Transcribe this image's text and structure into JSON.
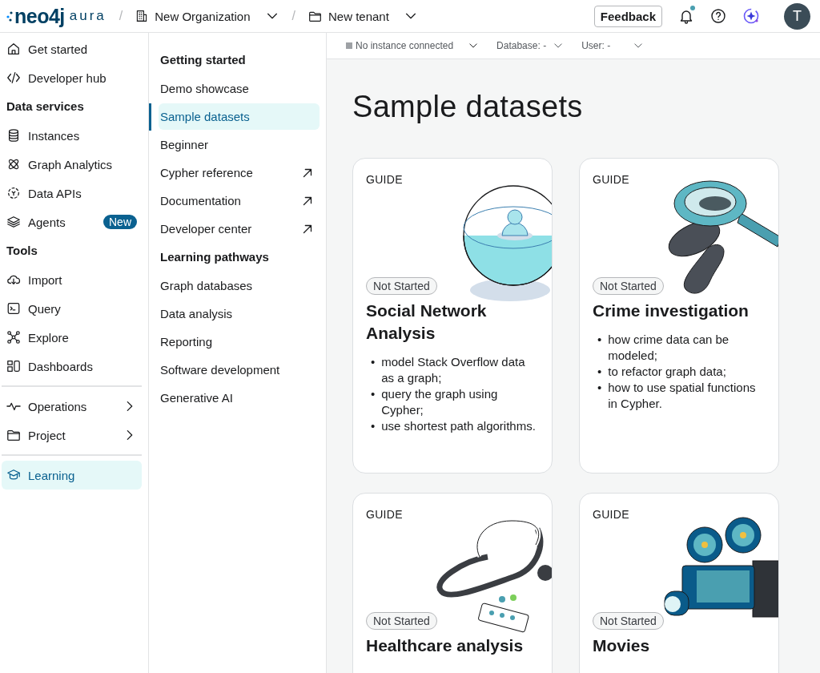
{
  "header": {
    "logo": {
      "brand": "neo4j",
      "product": "aura"
    },
    "separator": "/",
    "breadcrumbs": [
      {
        "label": "New Organization",
        "kind": "organization"
      },
      {
        "label": "New tenant",
        "kind": "folder"
      }
    ],
    "feedback": "Feedback",
    "notifications_unread": true,
    "avatar": "T"
  },
  "sidebar": {
    "sections": [
      {
        "items": [
          {
            "label": "Get started",
            "selected": false
          },
          {
            "label": "Developer hub",
            "selected": false
          }
        ]
      },
      {
        "heading": "Data services",
        "items": [
          {
            "label": "Instances",
            "selected": false
          },
          {
            "label": "Graph Analytics",
            "selected": false
          },
          {
            "label": "Data APIs",
            "selected": false
          },
          {
            "label": "Agents",
            "selected": false,
            "badge": "New"
          }
        ]
      },
      {
        "heading": "Tools",
        "items": [
          {
            "label": "Import",
            "selected": false
          },
          {
            "label": "Query",
            "selected": false
          },
          {
            "label": "Explore",
            "selected": false
          },
          {
            "label": "Dashboards",
            "selected": false
          }
        ]
      },
      {
        "divider": true,
        "items": [
          {
            "label": "Operations",
            "selected": false,
            "submenu": true
          },
          {
            "label": "Project",
            "selected": false,
            "submenu": true
          }
        ]
      },
      {
        "divider": true,
        "items": [
          {
            "label": "Learning",
            "selected": true
          }
        ]
      }
    ]
  },
  "learning_nav": {
    "groups": [
      {
        "heading": "Getting started",
        "items": [
          {
            "label": "Demo showcase",
            "selected": false,
            "external": false
          },
          {
            "label": "Sample datasets",
            "selected": true,
            "external": false
          },
          {
            "label": "Beginner",
            "selected": false,
            "external": false
          },
          {
            "label": "Cypher reference",
            "selected": false,
            "external": true
          },
          {
            "label": "Documentation",
            "selected": false,
            "external": true
          },
          {
            "label": "Developer center",
            "selected": false,
            "external": true
          }
        ]
      },
      {
        "heading": "Learning pathways",
        "items": [
          {
            "label": "Graph databases",
            "selected": false,
            "external": false
          },
          {
            "label": "Data analysis",
            "selected": false,
            "external": false
          },
          {
            "label": "Reporting",
            "selected": false,
            "external": false
          },
          {
            "label": "Software development",
            "selected": false,
            "external": false
          },
          {
            "label": "Generative AI",
            "selected": false,
            "external": false
          }
        ]
      }
    ]
  },
  "connection_bar": {
    "instance": "No instance connected",
    "database": "Database: -",
    "user": "User: -"
  },
  "page": {
    "title": "Sample datasets",
    "cards": [
      {
        "tag": "GUIDE",
        "status": "Not Started",
        "title": "Social Network Analysis",
        "bullet_marker": "•",
        "bullets": [
          "model Stack Overflow data as a graph;",
          "query the graph using Cypher;",
          "use shortest path algorithms."
        ]
      },
      {
        "tag": "GUIDE",
        "status": "Not Started",
        "title": "Crime investigation",
        "bullet_marker": "•",
        "bullets": [
          "how crime data can be modeled;",
          "to refactor graph data;",
          "how to use spatial functions in Cypher."
        ]
      },
      {
        "tag": "GUIDE",
        "status": "Not Started",
        "title": "Healthcare analysis"
      },
      {
        "tag": "GUIDE",
        "status": "Not Started",
        "title": "Movies"
      }
    ]
  }
}
